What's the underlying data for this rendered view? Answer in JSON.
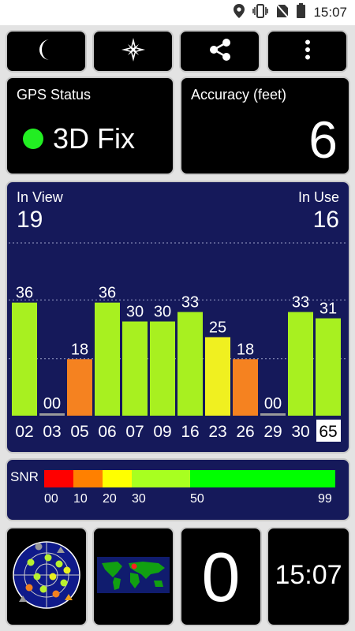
{
  "statusbar": {
    "time": "15:07",
    "icons": [
      "location-pin-icon",
      "vibrate-icon",
      "no-sim-icon",
      "battery-icon"
    ]
  },
  "toolbar": {
    "buttons": [
      "moon-icon",
      "compass-rose-icon",
      "share-icon",
      "overflow-menu-icon"
    ]
  },
  "gps_status": {
    "title": "GPS Status",
    "value": "3D Fix",
    "indicator_color": "#22ee22"
  },
  "accuracy": {
    "title": "Accuracy (feet)",
    "value": "6"
  },
  "satellites": {
    "in_view_label": "In View",
    "in_view": "19",
    "in_use_label": "In Use",
    "in_use": "16"
  },
  "chart_data": {
    "type": "bar",
    "categories": [
      "02",
      "03",
      "05",
      "06",
      "07",
      "09",
      "16",
      "23",
      "26",
      "29",
      "30",
      "65"
    ],
    "values": [
      36,
      0,
      18,
      36,
      30,
      30,
      33,
      25,
      18,
      0,
      33,
      31
    ],
    "value_labels": [
      "36",
      "00",
      "18",
      "36",
      "30",
      "30",
      "33",
      "25",
      "18",
      "00",
      "33",
      "31"
    ],
    "ylim": [
      0,
      55
    ],
    "highlighted_category": "65",
    "grid": true
  },
  "snr": {
    "label": "SNR",
    "ticks": [
      "00",
      "10",
      "20",
      "30",
      "50",
      "99"
    ],
    "colors": [
      "#ff0000",
      "#ff8000",
      "#ffff00",
      "#a8ff20",
      "#00ff00"
    ]
  },
  "bottom": {
    "radar_icon": "sky-radar-icon",
    "map_icon": "world-map-icon",
    "counter": "0",
    "clock": "15:07"
  }
}
